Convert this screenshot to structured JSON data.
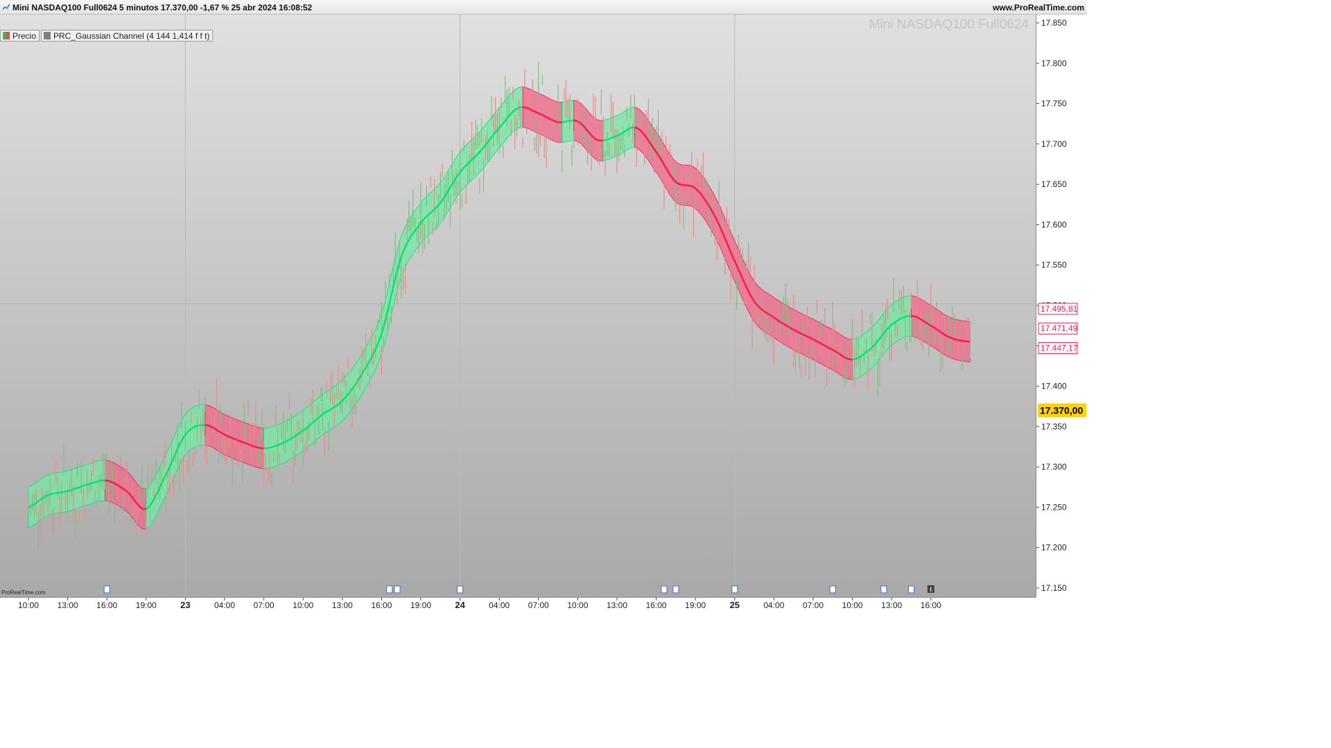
{
  "window": {
    "title": "Mini NASDAQ100 Full0624 5 minutos 17.370,00 -1,67 % 25 abr 2024 16:08:52",
    "website": "www.ProRealTime.com"
  },
  "legend": [
    {
      "label": "Precio",
      "color": "#e05050"
    },
    {
      "label": "PRC_Gaussian Channel (4 144 1,414 f f t)",
      "color": "#808080"
    }
  ],
  "watermark": "Mini NASDAQ100 Full0624",
  "brand": "ProRealTime.com",
  "colors": {
    "up": "#00e676",
    "up_fill": "#7be6a6",
    "down": "#ff1850",
    "down_fill": "#f06a8f",
    "candle_up": "#7fbf7f",
    "candle_down": "#e88a8a",
    "price_tag_bg": "#ffd200"
  },
  "chart_data": {
    "type": "line",
    "title": "Mini NASDAQ100 Full0624",
    "x_range": [
      "2024-04-22 10:00",
      "2024-04-25 16:08"
    ],
    "ylim": [
      17125,
      17875
    ],
    "y_ticks": [
      "17.150",
      "17.200",
      "17.250",
      "17.300",
      "17.350",
      "17.400",
      "17.450",
      "17.500",
      "17.550",
      "17.600",
      "17.650",
      "17.700",
      "17.750",
      "17.800",
      "17.850"
    ],
    "y_tick_values": [
      17150,
      17200,
      17250,
      17300,
      17350,
      17400,
      17450,
      17500,
      17550,
      17600,
      17650,
      17700,
      17750,
      17800,
      17850
    ],
    "x_ticks": [
      {
        "label": "10:00",
        "idx": 0,
        "major": false
      },
      {
        "label": "13:00",
        "idx": 1,
        "major": false
      },
      {
        "label": "16:00",
        "idx": 2,
        "major": false
      },
      {
        "label": "19:00",
        "idx": 3,
        "major": false
      },
      {
        "label": "23",
        "idx": 4,
        "major": true
      },
      {
        "label": "04:00",
        "idx": 5,
        "major": false
      },
      {
        "label": "07:00",
        "idx": 6,
        "major": false
      },
      {
        "label": "10:00",
        "idx": 7,
        "major": false
      },
      {
        "label": "13:00",
        "idx": 8,
        "major": false
      },
      {
        "label": "16:00",
        "idx": 9,
        "major": false
      },
      {
        "label": "19:00",
        "idx": 10,
        "major": false
      },
      {
        "label": "24",
        "idx": 11,
        "major": true
      },
      {
        "label": "04:00",
        "idx": 12,
        "major": false
      },
      {
        "label": "07:00",
        "idx": 13,
        "major": false
      },
      {
        "label": "10:00",
        "idx": 14,
        "major": false
      },
      {
        "label": "13:00",
        "idx": 15,
        "major": false
      },
      {
        "label": "16:00",
        "idx": 16,
        "major": false
      },
      {
        "label": "19:00",
        "idx": 17,
        "major": false
      },
      {
        "label": "25",
        "idx": 18,
        "major": true
      },
      {
        "label": "04:00",
        "idx": 19,
        "major": false
      },
      {
        "label": "07:00",
        "idx": 20,
        "major": false
      },
      {
        "label": "10:00",
        "idx": 21,
        "major": false
      },
      {
        "label": "13:00",
        "idx": 22,
        "major": false
      },
      {
        "label": "16:00",
        "idx": 23,
        "major": false
      }
    ],
    "series": [
      {
        "name": "PRC_Gaussian Channel",
        "x_index": [
          0,
          0.5,
          1,
          1.5,
          2,
          2.5,
          3,
          3.5,
          4,
          4.5,
          5,
          5.5,
          6,
          6.5,
          7,
          7.5,
          8,
          8.5,
          9,
          9.5,
          10,
          10.5,
          11,
          11.5,
          12,
          12.5,
          13,
          13.5,
          14,
          14.5,
          15,
          15.5,
          16,
          16.5,
          17,
          17.5,
          18,
          18.5,
          19,
          19.5,
          20,
          20.5,
          21,
          21.5,
          22,
          22.5,
          23,
          23.5,
          24
        ],
        "values": [
          17250,
          17265,
          17270,
          17278,
          17283,
          17270,
          17248,
          17290,
          17340,
          17352,
          17340,
          17330,
          17323,
          17330,
          17345,
          17365,
          17382,
          17415,
          17465,
          17560,
          17602,
          17627,
          17665,
          17690,
          17720,
          17745,
          17738,
          17727,
          17728,
          17705,
          17710,
          17720,
          17690,
          17653,
          17645,
          17610,
          17555,
          17505,
          17485,
          17470,
          17458,
          17445,
          17433,
          17448,
          17476,
          17487,
          17475,
          17460,
          17455
        ],
        "band_half_width": 25
      },
      {
        "name": "Precio",
        "last": 17370.0,
        "change_pct": -1.67
      }
    ],
    "price_labels": [
      {
        "value": 17495.81,
        "label": "17.495,81"
      },
      {
        "value": 17471.49,
        "label": "17.471,49"
      },
      {
        "value": 17447.17,
        "label": "17.447,17"
      }
    ],
    "last_price": {
      "value": 17370.0,
      "label": "17.370,00"
    },
    "news_markers_idx": [
      2,
      9.2,
      9.4,
      11,
      16.2,
      16.5,
      18,
      20.5,
      21.8,
      22.5
    ],
    "info_marker_idx": 23
  }
}
